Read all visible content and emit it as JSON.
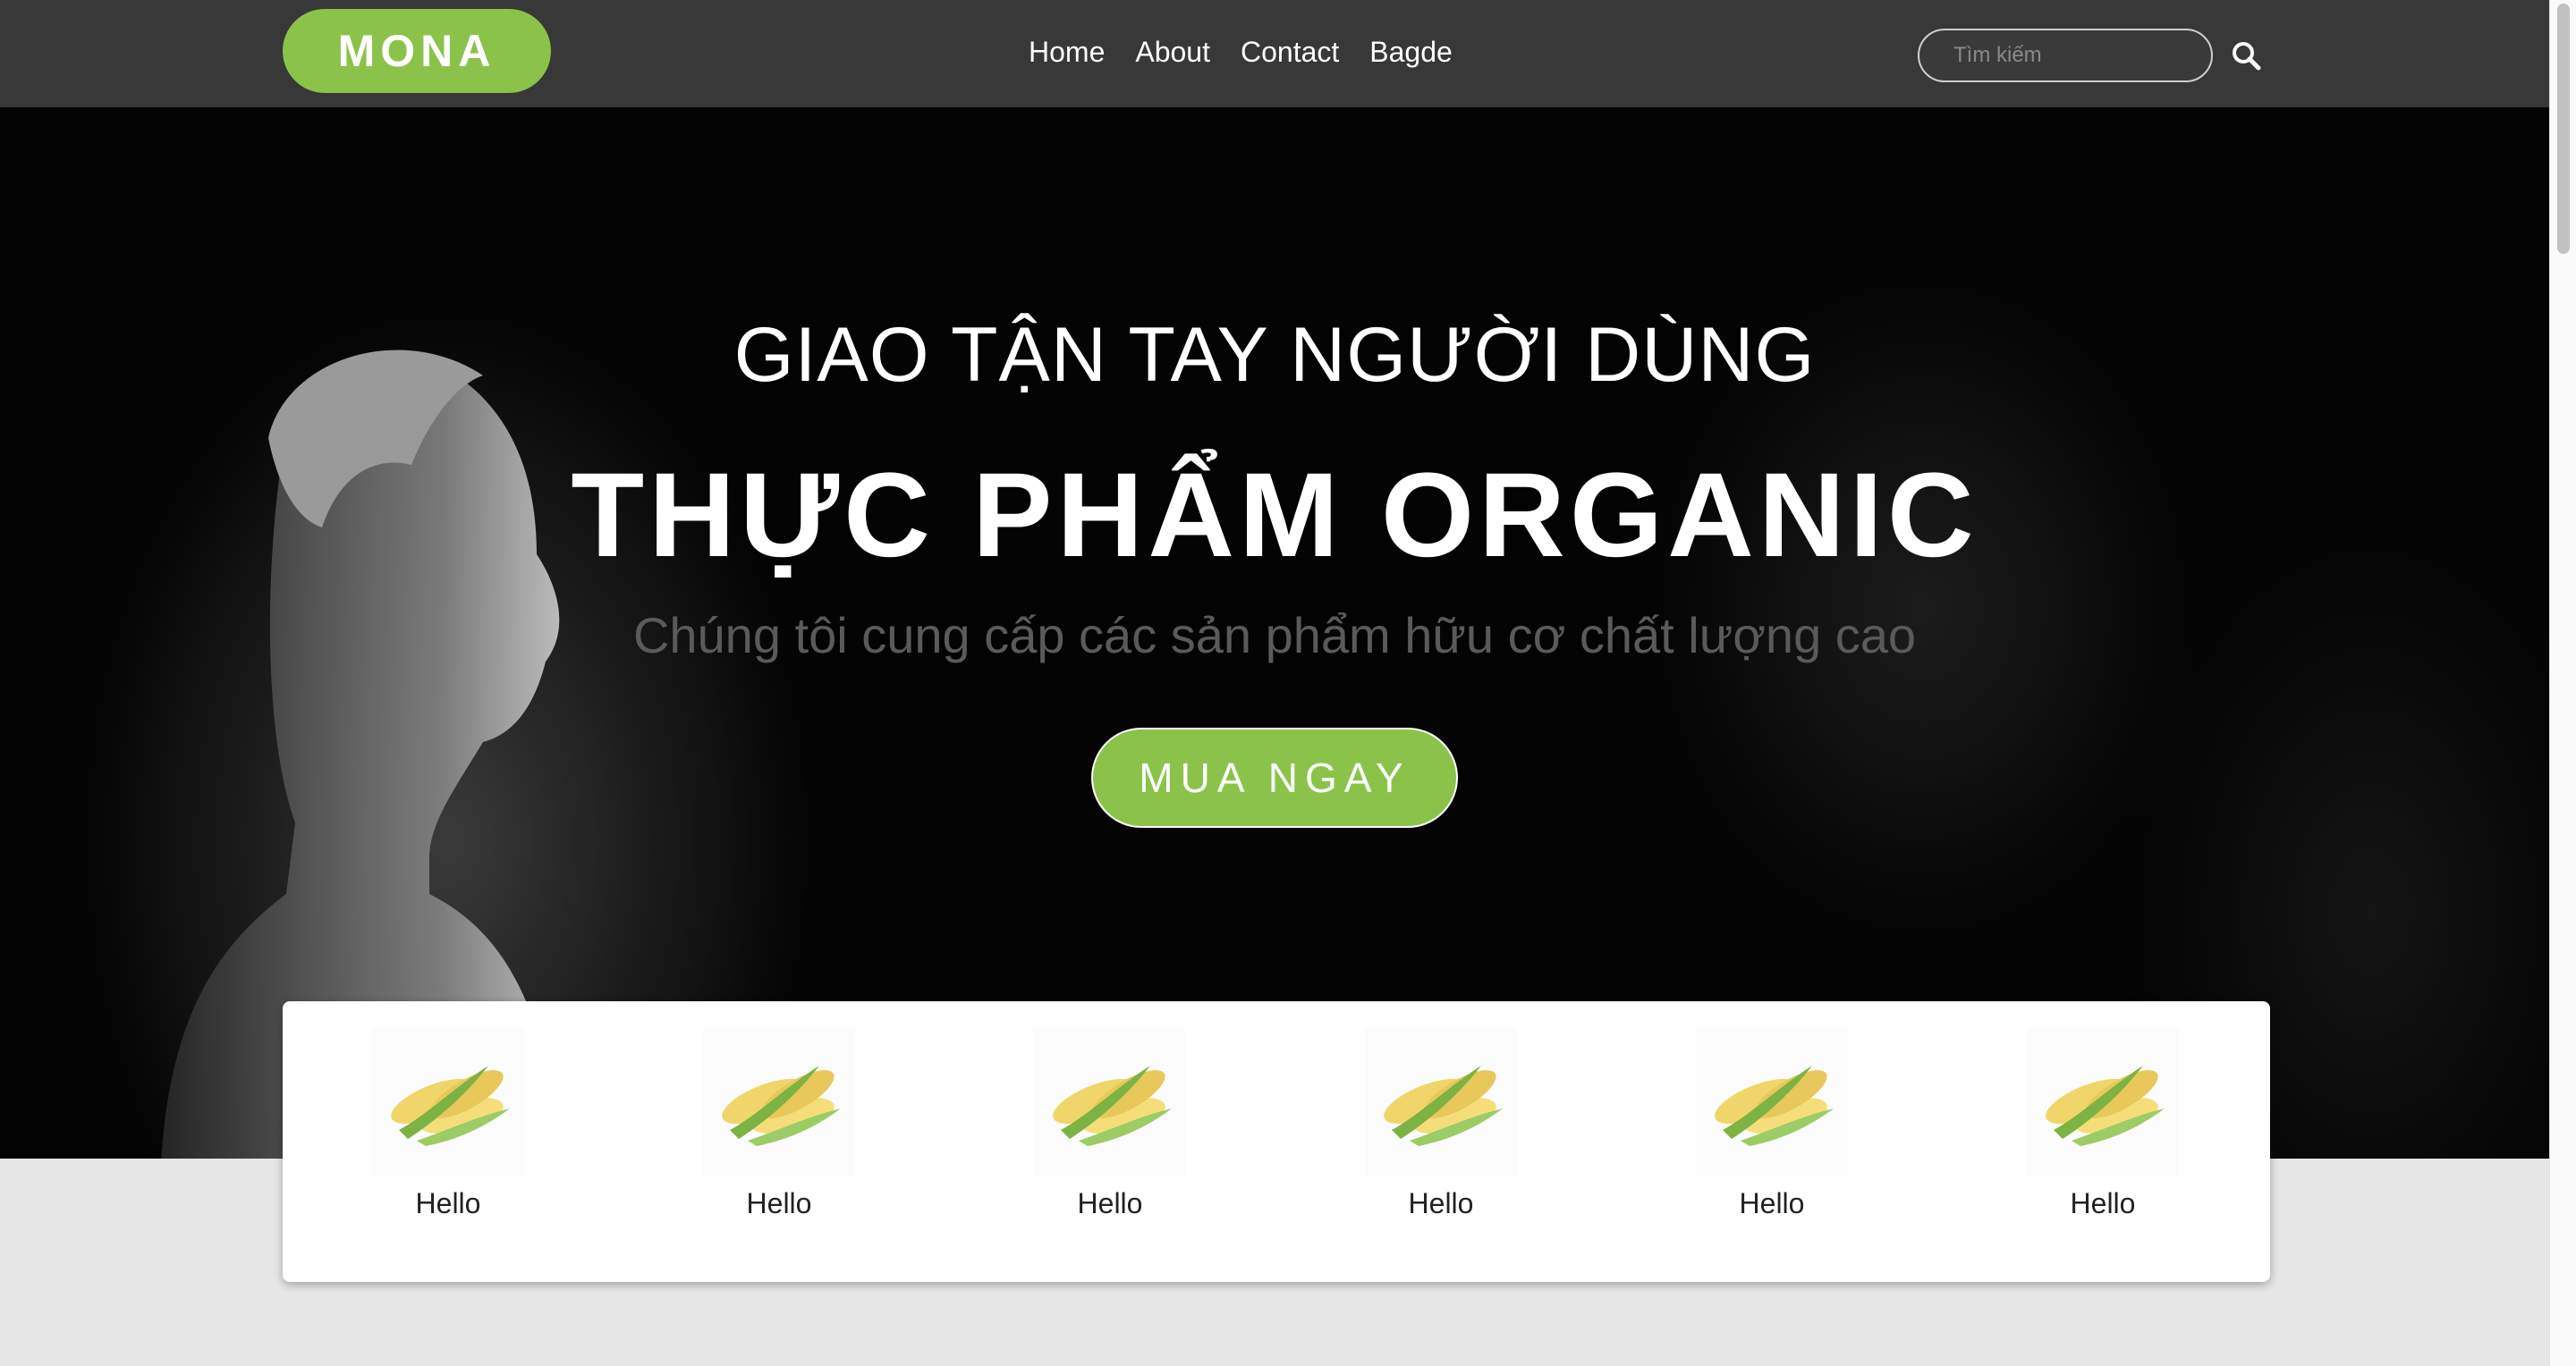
{
  "header": {
    "logo": "MONA",
    "nav": [
      "Home",
      "About",
      "Contact",
      "Bagde"
    ],
    "search": {
      "placeholder": "Tìm kiếm",
      "icon": "search-icon"
    }
  },
  "hero": {
    "subtitle": "GIAO TẬN TAY NGƯỜI DÙNG",
    "title": "THỰC PHẨM ORGANIC",
    "description": "Chúng tôi cung cấp các sản phẩm hữu cơ chất lượng cao",
    "cta_label": "MUA NGAY"
  },
  "products": [
    {
      "name": "Hello",
      "icon": "corn-image"
    },
    {
      "name": "Hello",
      "icon": "corn-image"
    },
    {
      "name": "Hello",
      "icon": "corn-image"
    },
    {
      "name": "Hello",
      "icon": "corn-image"
    },
    {
      "name": "Hello",
      "icon": "corn-image"
    },
    {
      "name": "Hello",
      "icon": "corn-image"
    }
  ],
  "colors": {
    "accent": "#8bc34a",
    "header_bg": "#383838",
    "hero_bg": "#030303",
    "page_bg": "#e6e6e6"
  }
}
